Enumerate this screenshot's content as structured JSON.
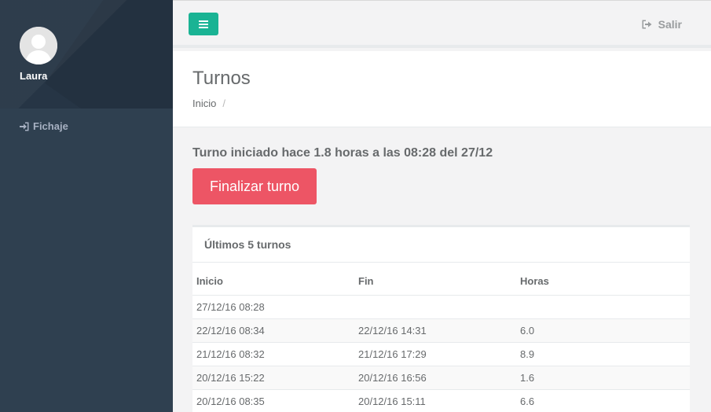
{
  "sidebar": {
    "user_name": "Laura",
    "avatar_icon": "user-silhouette-icon",
    "items": [
      {
        "label": "Fichaje",
        "icon": "sign-in-icon"
      }
    ]
  },
  "topbar": {
    "menu_icon": "bars-icon",
    "logout_label": "Salir",
    "logout_icon": "sign-out-icon",
    "accent_color": "#1ab394"
  },
  "heading": {
    "title": "Turnos",
    "breadcrumb": [
      "Inicio",
      "/"
    ]
  },
  "main": {
    "status_text": "Turno iniciado hace 1.8 horas a las 08:28 del 27/12",
    "finish_button_label": "Finalizar turno",
    "finish_button_color": "#ed5565",
    "panel_title": "Últimos 5 turnos",
    "table": {
      "headers": [
        "Inicio",
        "Fin",
        "Horas"
      ],
      "rows": [
        [
          "27/12/16 08:28",
          "",
          ""
        ],
        [
          "22/12/16 08:34",
          "22/12/16 14:31",
          "6.0"
        ],
        [
          "21/12/16 08:32",
          "21/12/16 17:29",
          "8.9"
        ],
        [
          "20/12/16 15:22",
          "20/12/16 16:56",
          "1.6"
        ],
        [
          "20/12/16 08:35",
          "20/12/16 15:11",
          "6.6"
        ]
      ]
    }
  }
}
